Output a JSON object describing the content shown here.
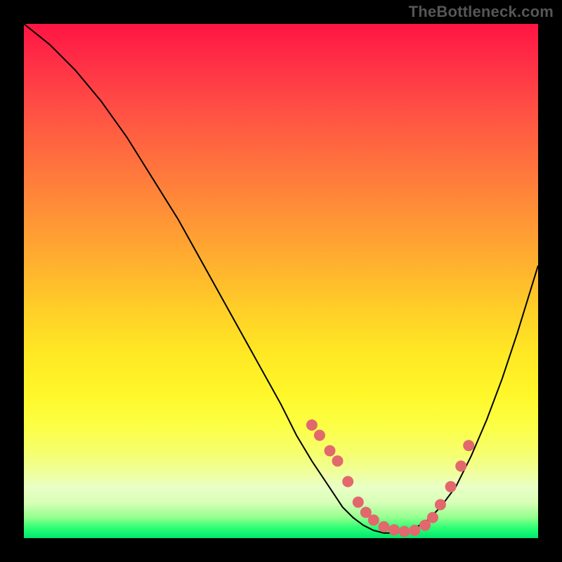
{
  "attribution": "TheBottleneck.com",
  "chart_data": {
    "type": "line",
    "title": "",
    "xlabel": "",
    "ylabel": "",
    "xlim": [
      0,
      100
    ],
    "ylim": [
      0,
      100
    ],
    "series": [
      {
        "name": "bottleneck-curve",
        "x": [
          0,
          5,
          10,
          15,
          20,
          25,
          30,
          35,
          40,
          45,
          50,
          53,
          56,
          58,
          60,
          62,
          64,
          66,
          68,
          70,
          72,
          75,
          78,
          81,
          84,
          87,
          90,
          93,
          96,
          100
        ],
        "y": [
          100,
          96,
          91,
          85,
          78,
          70,
          62,
          53,
          44,
          35,
          26,
          20,
          15,
          12,
          9,
          6,
          4,
          2.5,
          1.5,
          1,
          1,
          1.5,
          3,
          6,
          10,
          16,
          23,
          31,
          40,
          53
        ]
      }
    ],
    "markers": {
      "name": "highlight-points",
      "x": [
        56,
        57.5,
        59.5,
        61,
        63,
        65,
        66.5,
        68,
        70,
        72,
        74,
        76,
        78,
        79.5,
        81,
        83,
        85,
        86.5
      ],
      "y": [
        22,
        20,
        17,
        15,
        11,
        7,
        5,
        3.5,
        2.2,
        1.6,
        1.3,
        1.5,
        2.5,
        4,
        6.5,
        10,
        14,
        18
      ]
    },
    "colors": {
      "gradient_top": "#ff1543",
      "gradient_mid": "#ffe824",
      "gradient_bottom": "#00e66e",
      "curve": "#000000",
      "marker": "#e2686d"
    }
  }
}
